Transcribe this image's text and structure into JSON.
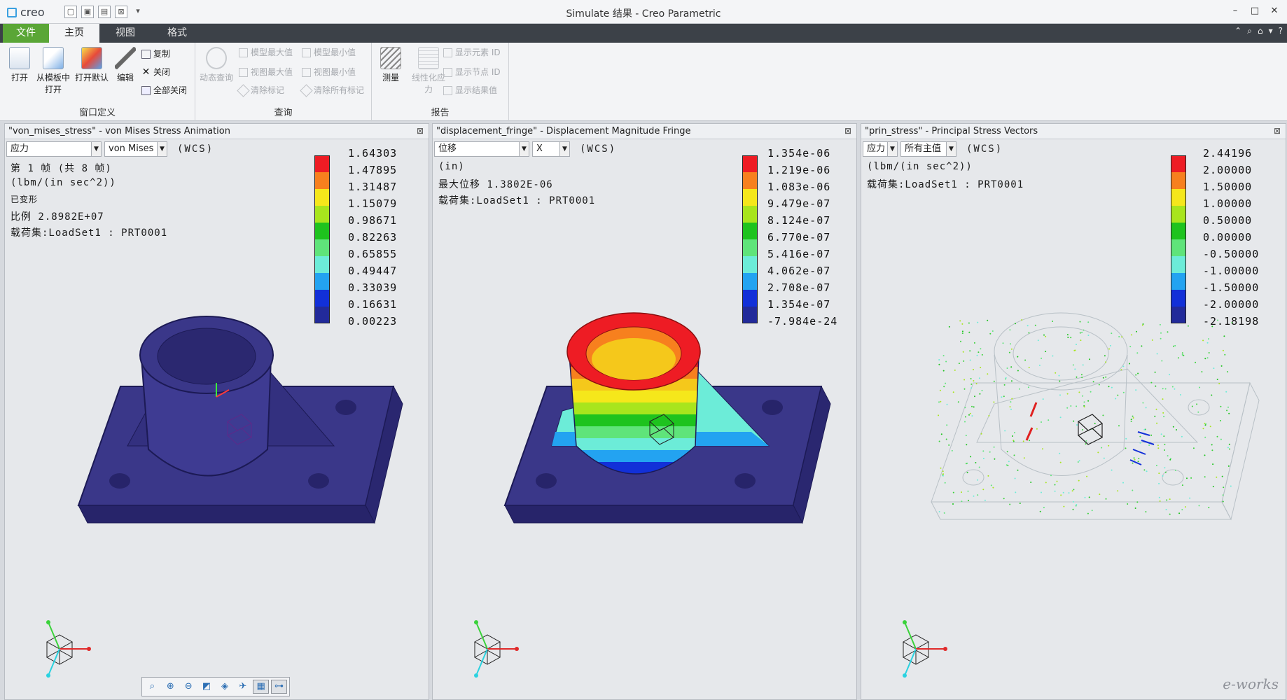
{
  "app": {
    "logo_text": "creo",
    "title": "Simulate 结果 - Creo Parametric",
    "window_controls": [
      "–",
      "□",
      "✕"
    ]
  },
  "tabs": {
    "file": "文件",
    "home": "主页",
    "view": "视图",
    "format": "格式"
  },
  "ribbon": {
    "window_def": {
      "label": "窗口定义",
      "open": "打开",
      "open_template_1": "从模板中",
      "open_template_2": "打开",
      "open_default": "打开默认",
      "edit": "编辑",
      "copy": "复制",
      "close": "关闭",
      "close_all": "全部关闭"
    },
    "query": {
      "label": "查询",
      "dynamic_query": "动态查询",
      "model_max": "模型最大值",
      "model_min": "模型最小值",
      "view_max": "视图最大值",
      "view_min": "视图最小值",
      "clear_mark": "清除标记",
      "clear_all_marks": "清除所有标记"
    },
    "report": {
      "label": "报告",
      "measure": "测量",
      "linearize_1": "线性化应",
      "linearize_2": "力",
      "show_element_id": "显示元素 ID",
      "show_node_id": "显示节点 ID",
      "show_result": "显示结果值"
    }
  },
  "panels": [
    {
      "title": "\"von_mises_stress\" - von Mises Stress Animation",
      "dd1": "应力",
      "dd2": "von Mises",
      "wcs": "(WCS)",
      "info": [
        "第 1 帧 (共 8 帧)",
        "(lbm/(in sec^2))",
        "已变形",
        "比例  2.8982E+07",
        "载荷集:LoadSet1  :  PRT0001"
      ],
      "legend": [
        "1.64303",
        "1.47895",
        "1.31487",
        "1.15079",
        "0.98671",
        "0.82263",
        "0.65855",
        "0.49447",
        "0.33039",
        "0.16631",
        "0.00223"
      ]
    },
    {
      "title": "\"displacement_fringe\" - Displacement Magnitude Fringe",
      "dd1": "位移",
      "dd2": "X",
      "wcs": "(WCS)",
      "info": [
        "(in)",
        "最大位移  1.3802E-06",
        "载荷集:LoadSet1  :  PRT0001"
      ],
      "legend": [
        "1.354e-06",
        "1.219e-06",
        "1.083e-06",
        "9.479e-07",
        "8.124e-07",
        "6.770e-07",
        "5.416e-07",
        "4.062e-07",
        "2.708e-07",
        "1.354e-07",
        "-7.984e-24"
      ]
    },
    {
      "title": "\"prin_stress\" - Principal Stress Vectors",
      "dd1": "应力",
      "dd2": "所有主值",
      "wcs": "(WCS)",
      "info": [
        "(lbm/(in sec^2))",
        "载荷集:LoadSet1  :  PRT0001"
      ],
      "legend": [
        "2.44196",
        "2.00000",
        "1.50000",
        "1.00000",
        "0.50000",
        "0.00000",
        "-0.50000",
        "-1.00000",
        "-1.50000",
        "-2.00000",
        "-2.18198"
      ]
    }
  ],
  "legend_colors": [
    "#ee1c24",
    "#f7801e",
    "#f5e71b",
    "#a8e51d",
    "#1ec31e",
    "#5fe47a",
    "#6cecd8",
    "#23a3f1",
    "#1230d8",
    "#222a9a"
  ],
  "watermark": "e-works"
}
